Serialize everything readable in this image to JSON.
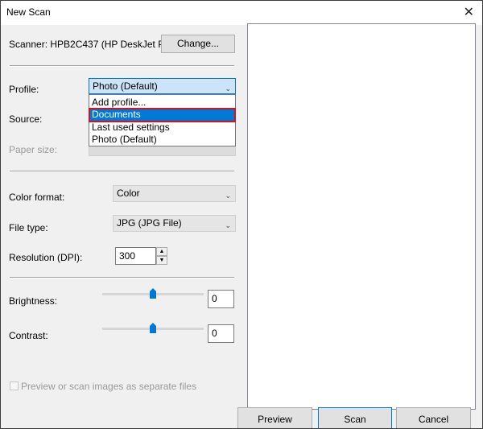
{
  "window": {
    "title": "New Scan",
    "close_glyph": "✕"
  },
  "scanner": {
    "label": "Scanner: HPB2C437 (HP DeskJet Pl...",
    "change_button": "Change..."
  },
  "profile": {
    "label": "Profile:",
    "selected": "Photo (Default)",
    "options": [
      "Add profile...",
      "Documents",
      "Last used settings",
      "Photo (Default)"
    ],
    "highlighted_option": "Documents"
  },
  "source": {
    "label": "Source:"
  },
  "paper_size": {
    "label": "Paper size:"
  },
  "color_format": {
    "label": "Color format:",
    "value": "Color"
  },
  "file_type": {
    "label": "File type:",
    "value": "JPG (JPG File)"
  },
  "resolution": {
    "label": "Resolution (DPI):",
    "value": "300"
  },
  "brightness": {
    "label": "Brightness:",
    "value": "0",
    "level": 0.5
  },
  "contrast": {
    "label": "Contrast:",
    "value": "0",
    "level": 0.5
  },
  "separate_files": {
    "label": "Preview or scan images as separate files",
    "checked": false,
    "enabled": false
  },
  "buttons": {
    "preview": "Preview",
    "scan": "Scan",
    "cancel": "Cancel"
  },
  "colors": {
    "accent": "#0078d7",
    "highlight_outline": "#d8121b",
    "selection_bg": "#cce4f7",
    "thumb": "#0078d7"
  },
  "icons": [
    "close-icon",
    "chevron-down-icon",
    "spin-up-icon",
    "spin-down-icon",
    "slider-thumb"
  ]
}
